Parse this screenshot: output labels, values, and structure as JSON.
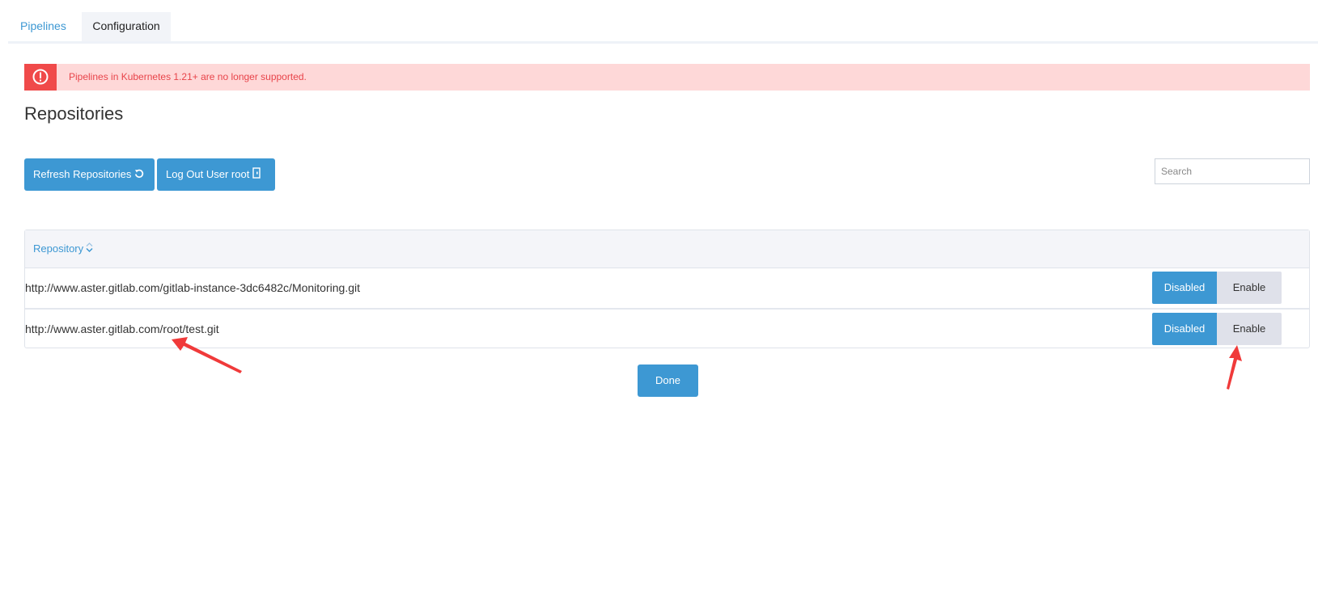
{
  "tabs": [
    {
      "label": "Pipelines"
    },
    {
      "label": "Configuration"
    }
  ],
  "alert": {
    "icon": "alert-circle-icon",
    "message": "Pipelines in Kubernetes 1.21+ are no longer supported.",
    "background": "#fed8d8",
    "accent": "#f04a4a"
  },
  "page": {
    "title": "Repositories"
  },
  "toolbar": {
    "refresh_label": "Refresh Repositories",
    "refresh_icon": "refresh-icon",
    "logout_label": "Log Out User root",
    "logout_icon": "sign-out-icon",
    "search_placeholder": "Search"
  },
  "table": {
    "columns": [
      "Repository"
    ],
    "rows": [
      {
        "url": "http://www.aster.gitlab.com/gitlab-instance-3dc6482c/Monitoring.git",
        "state_active": "Disabled",
        "state_other": "Enable"
      },
      {
        "url": "http://www.aster.gitlab.com/root/test.git",
        "state_active": "Disabled",
        "state_other": "Enable"
      }
    ]
  },
  "footer": {
    "done_label": "Done"
  },
  "colors": {
    "accent": "#3d98d3",
    "annotation_arrow": "#f03a3a"
  }
}
